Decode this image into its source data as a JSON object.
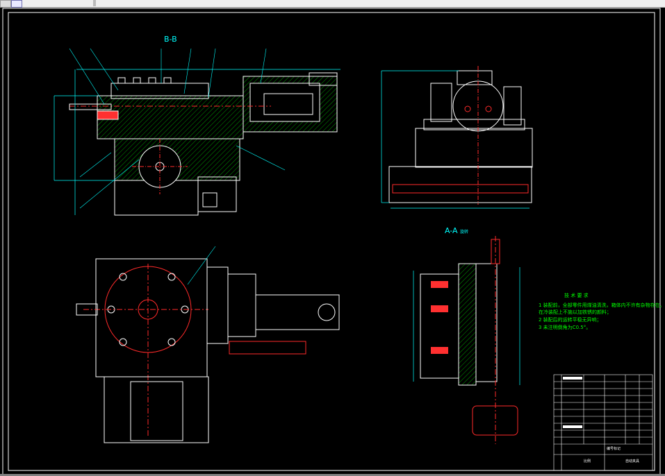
{
  "views": {
    "section_bb_label": "B-B",
    "section_aa_label": "A-A",
    "section_aa_suffix": "旋转"
  },
  "notes": {
    "title": "技 术 要 求",
    "lines": [
      "1  装配前，全部零件用煤油清洗，箱体内不许有杂物存在。",
      "    在冷装配上不施以加铁锈的颜料；",
      "2  装配后的运转平稳无异响；",
      "3  未注明倒角为C0.5°。"
    ]
  },
  "title_block": {
    "company": "编号标记",
    "drawing_name": "自动夹具",
    "scale_label": "比例"
  },
  "colors": {
    "outline": "#ffffff",
    "frame": "#ffffff",
    "centerline": "#ff2a2a",
    "hatch": "#00ff00",
    "dimension": "#00ffff",
    "label": "#00ffff"
  }
}
